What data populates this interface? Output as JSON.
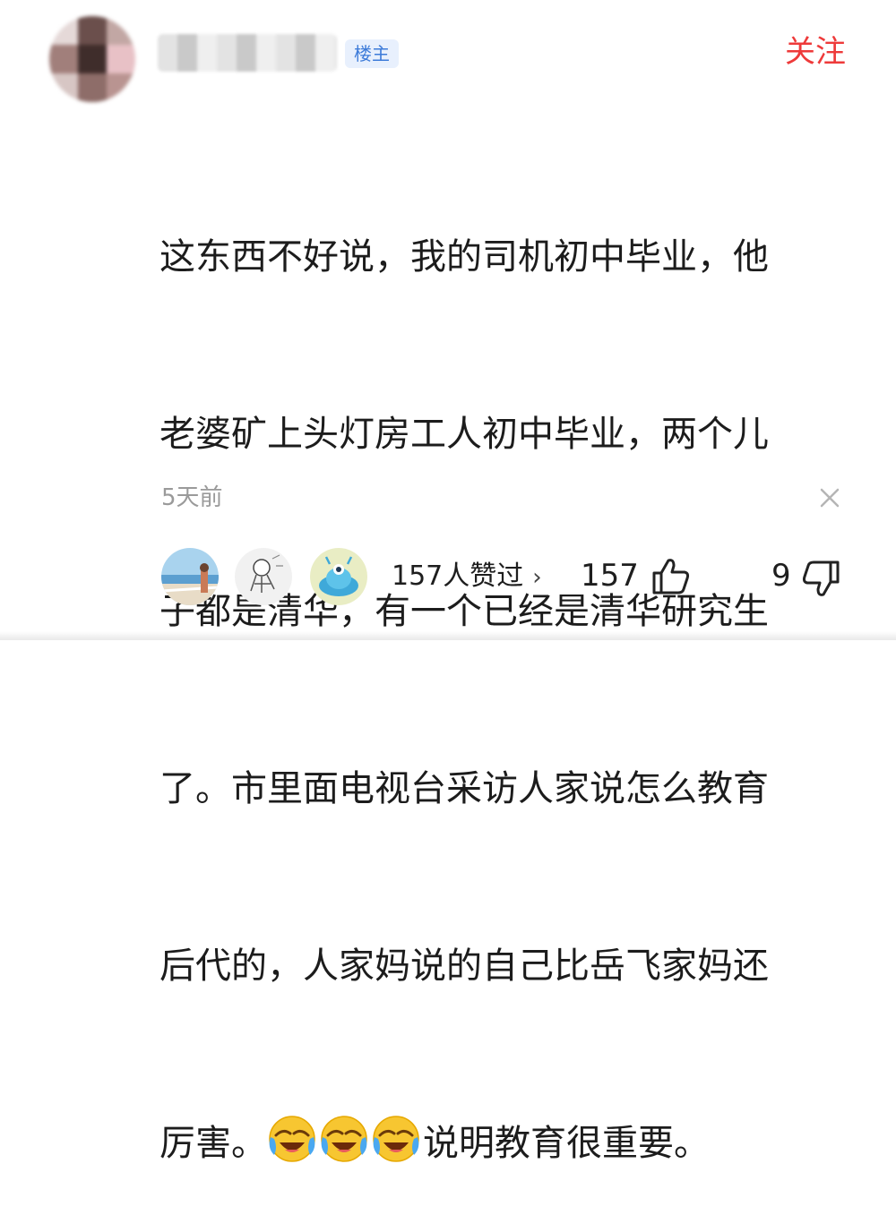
{
  "comment": {
    "badge": "楼主",
    "follow_label": "关注",
    "text_lines": [
      "这东西不好说，我的司机初中毕业，他",
      "老婆矿上头灯房工人初中毕业，两个儿",
      "子都是清华，有一个已经是清华研究生",
      "了。市里面电视台采访人家说怎么教育",
      "后代的，人家妈说的自己比岳飞家妈还"
    ],
    "last_line_start": "厉害。",
    "emojis": [
      "crying-laughing-emoji",
      "crying-laughing-emoji",
      "crying-laughing-emoji"
    ],
    "last_line_end": "说明教育很重要。",
    "time": "5天前"
  },
  "footer": {
    "likes_text": "157人赞过",
    "chevron": "›",
    "like_count": "157",
    "dislike_count": "9",
    "icons": [
      "thumbs-up-icon",
      "thumbs-down-icon",
      "close-icon"
    ]
  },
  "colors": {
    "follow": "#ee3a3a",
    "badge_bg": "#e8f0fd",
    "badge_text": "#3d7bd9",
    "time": "#9a9a9a"
  }
}
